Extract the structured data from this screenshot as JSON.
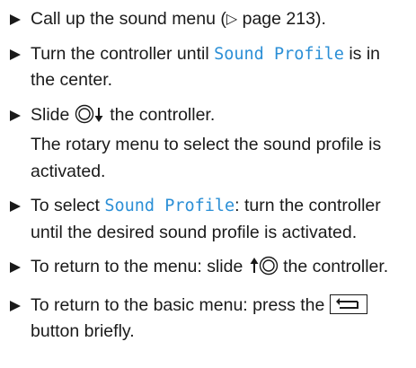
{
  "steps": {
    "s1": {
      "text": "Call up the sound menu (",
      "ref_icon": "triangle-right-outline-icon",
      "ref": " page 213)."
    },
    "s2": {
      "pre": "Turn the controller until ",
      "kw": "Sound Profile",
      "post": " is in the center."
    },
    "s3": {
      "pre": "Slide ",
      "icon": "controller-slide-down-icon",
      "post": " the controller.",
      "line2": "The rotary menu to select the sound profile is activated."
    },
    "s4": {
      "pre": "To select ",
      "kw": "Sound Profile",
      "post": ": turn the controller until the desired sound profile is activated."
    },
    "s5": {
      "pre": "To return to the menu: slide ",
      "icon": "controller-slide-up-icon",
      "post": " the controller."
    },
    "s6": {
      "pre": "To return to the basic menu: press the ",
      "icon": "back-button-icon",
      "post": " button briefly."
    }
  },
  "colors": {
    "keyword": "#2b8fd6",
    "text": "#1a1a1a"
  }
}
